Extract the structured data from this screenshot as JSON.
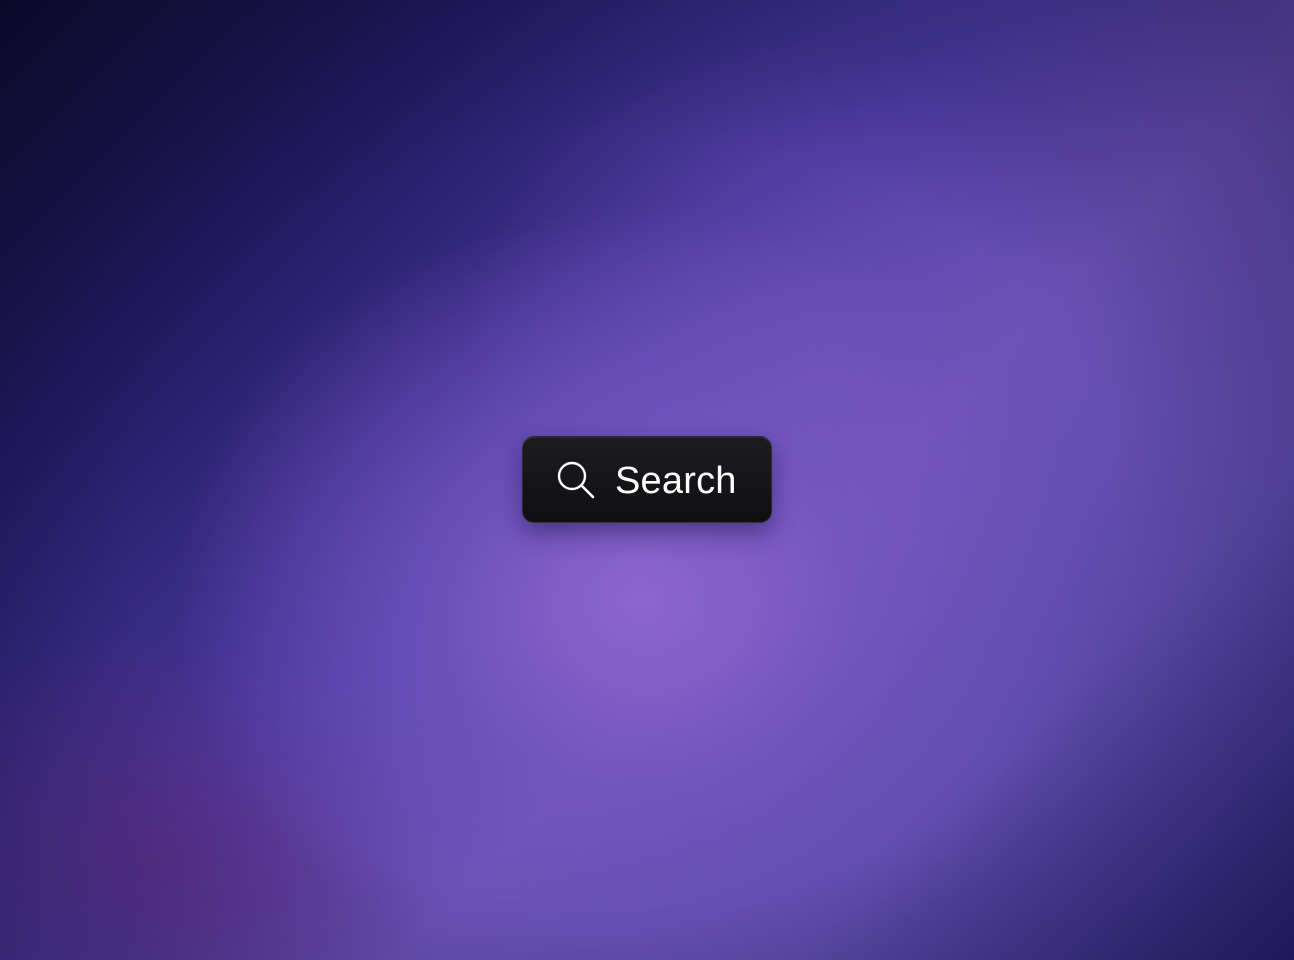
{
  "page": {
    "background_colors": [
      "#0b0a2a",
      "#231a62",
      "#4a3aa0",
      "#8e68ce",
      "#2a2070"
    ]
  },
  "search": {
    "label": "Search",
    "icon": "search-icon",
    "button_background": "#141417",
    "text_color": "#ffffff"
  }
}
